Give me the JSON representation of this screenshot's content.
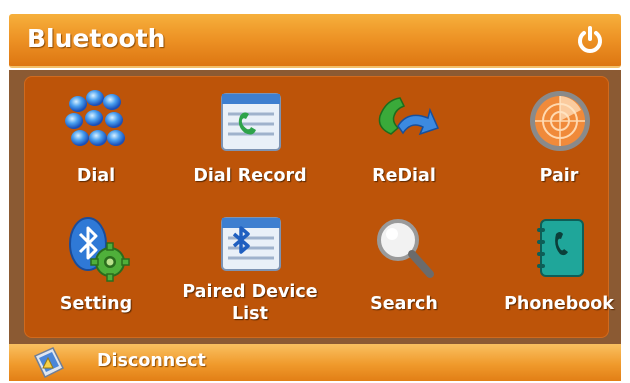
{
  "header": {
    "title": "Bluetooth",
    "power_icon": "power-icon"
  },
  "tiles": [
    {
      "label": "Dial",
      "icon": "dial-keypad-icon"
    },
    {
      "label": "Dial Record",
      "icon": "dial-record-icon"
    },
    {
      "label": "ReDial",
      "icon": "redial-icon"
    },
    {
      "label": "Pair",
      "icon": "pair-radar-icon"
    },
    {
      "label": "Setting",
      "icon": "bluetooth-gear-icon"
    },
    {
      "label_line1": "Paired Device",
      "label_line2": "List",
      "icon": "paired-device-list-icon"
    },
    {
      "label": "Search",
      "icon": "magnifier-icon"
    },
    {
      "label": "Phonebook",
      "icon": "phonebook-icon"
    }
  ],
  "footer": {
    "label": "Disconnect",
    "icon": "disconnect-device-icon"
  },
  "colors": {
    "header_orange": "#ee9426",
    "grid_orange": "#bd5409",
    "frame_brown": "#8b5a33"
  }
}
